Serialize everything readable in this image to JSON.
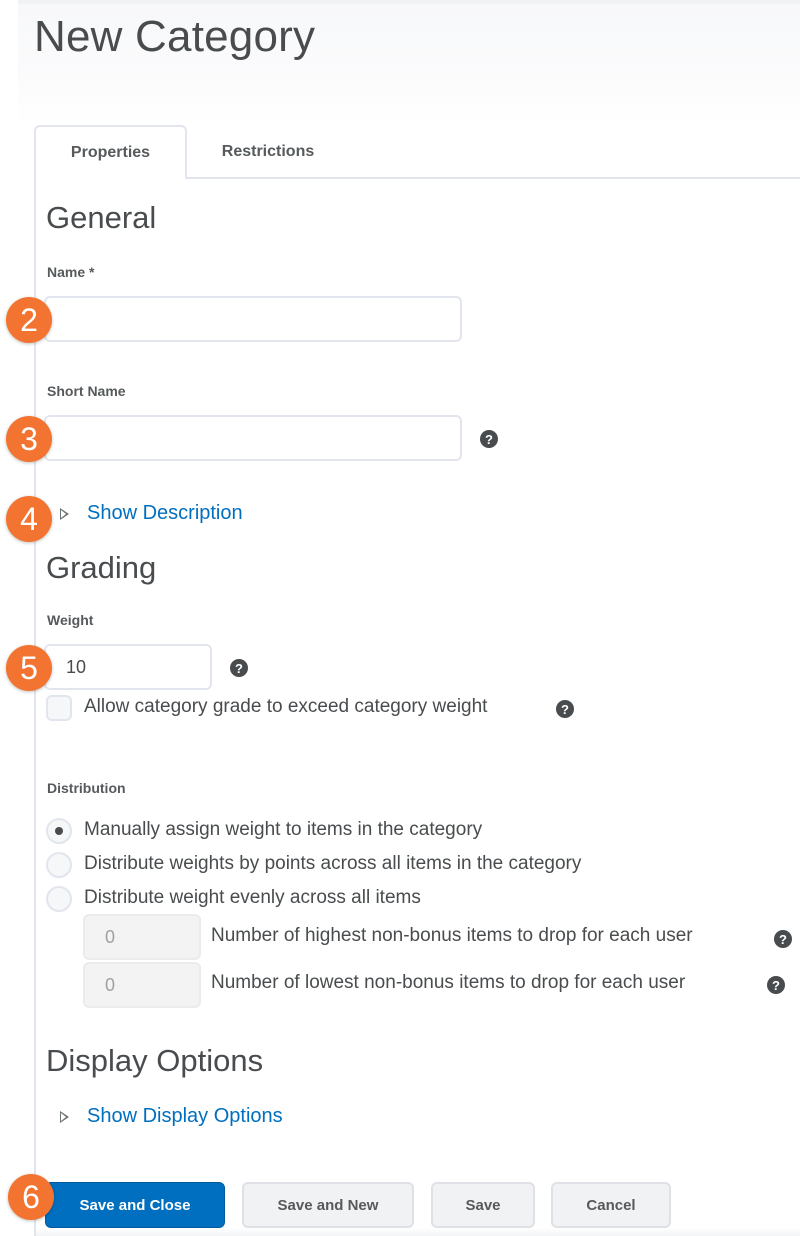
{
  "page": {
    "title": "New Category"
  },
  "tabs": [
    {
      "label": "Properties",
      "active": true
    },
    {
      "label": "Restrictions",
      "active": false
    }
  ],
  "general": {
    "heading": "General",
    "name_label": "Name *",
    "name_value": "",
    "short_name_label": "Short Name",
    "short_name_value": "",
    "show_description": "Show Description"
  },
  "grading": {
    "heading": "Grading",
    "weight_label": "Weight",
    "weight_value": "10",
    "exceed_checkbox_label": "Allow category grade to exceed category weight",
    "exceed_checked": false,
    "distribution_label": "Distribution",
    "distribution_options": [
      {
        "label": "Manually assign weight to items in the category",
        "selected": true
      },
      {
        "label": "Distribute weights by points across all items in the category",
        "selected": false
      },
      {
        "label": "Distribute weight evenly across all items",
        "selected": false
      }
    ],
    "drop_highest_value": "0",
    "drop_highest_label": "Number of highest non-bonus items to drop for each user",
    "drop_lowest_value": "0",
    "drop_lowest_label": "Number of lowest non-bonus items to drop for each user"
  },
  "display_options": {
    "heading": "Display Options",
    "show_display_options": "Show Display Options"
  },
  "buttons": {
    "save_and_close": "Save and Close",
    "save_and_new": "Save and New",
    "save": "Save",
    "cancel": "Cancel"
  },
  "callouts": [
    "2",
    "3",
    "4",
    "5",
    "6"
  ],
  "icons": {
    "help": "?"
  },
  "colors": {
    "accent": "#006fbf",
    "callout": "#f27430",
    "text": "#494c4e",
    "border": "#e3e5ee"
  }
}
